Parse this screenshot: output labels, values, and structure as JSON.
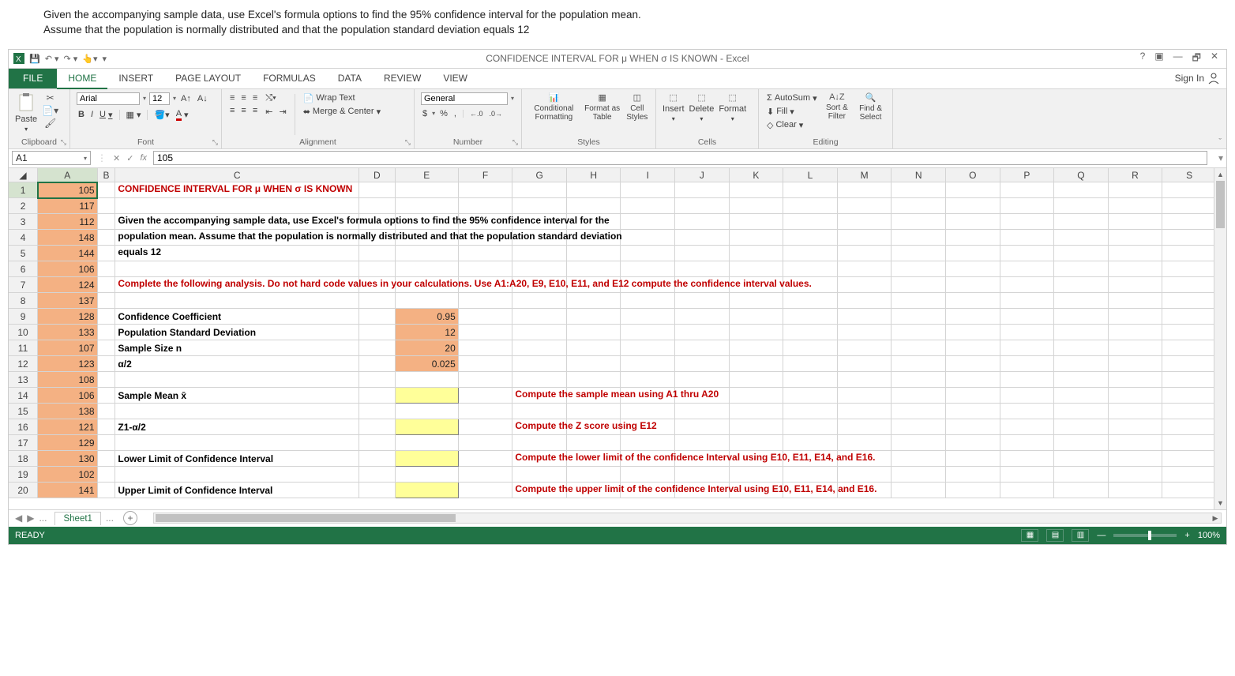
{
  "problem": {
    "line1": "Given the accompanying sample data, use Excel's formula options to find the 95% confidence interval for the population mean.",
    "line2": "Assume that the population is normally distributed and that the population standard deviation equals 12"
  },
  "titlebar": {
    "doc_title": "CONFIDENCE INTERVAL FOR μ WHEN σ IS KNOWN - Excel",
    "help": "?",
    "ribbon_opts": "▣",
    "minimize": "—",
    "restore": "🗗",
    "close": "✕"
  },
  "tabs": {
    "file": "FILE",
    "items": [
      "HOME",
      "INSERT",
      "PAGE LAYOUT",
      "FORMULAS",
      "DATA",
      "REVIEW",
      "VIEW"
    ],
    "sign_in": "Sign In"
  },
  "ribbon": {
    "clipboard": {
      "label": "Clipboard",
      "paste": "Paste"
    },
    "font": {
      "label": "Font",
      "name": "Arial",
      "size": "12",
      "bold": "B",
      "italic": "I",
      "underline": "U"
    },
    "alignment": {
      "label": "Alignment",
      "wrap": "Wrap Text",
      "merge": "Merge & Center"
    },
    "number": {
      "label": "Number",
      "format": "General",
      "currency": "$",
      "percent": "%",
      "comma": ",",
      "inc": "←.0 .00",
      "dec": ".00 →.0"
    },
    "styles": {
      "label": "Styles",
      "cond": "Conditional Formatting",
      "fat": "Format as Table",
      "cell": "Cell Styles"
    },
    "cells": {
      "label": "Cells",
      "insert": "Insert",
      "delete": "Delete",
      "format": "Format"
    },
    "editing": {
      "label": "Editing",
      "autosum": "AutoSum",
      "fill": "Fill",
      "clear": "Clear",
      "sort": "Sort & Filter",
      "find": "Find & Select"
    }
  },
  "namebox": {
    "ref": "A1",
    "fx": "fx",
    "formula": "105"
  },
  "columns": [
    "A",
    "B",
    "C",
    "D",
    "E",
    "F",
    "G",
    "H",
    "I",
    "J",
    "K",
    "L",
    "M",
    "N",
    "O",
    "P",
    "Q",
    "R",
    "S"
  ],
  "rows": [
    1,
    2,
    3,
    4,
    5,
    6,
    7,
    8,
    9,
    10,
    11,
    12,
    13,
    14,
    15,
    16,
    17,
    18,
    19,
    20
  ],
  "data_A": [
    "105",
    "117",
    "112",
    "148",
    "144",
    "106",
    "124",
    "137",
    "128",
    "133",
    "107",
    "123",
    "108",
    "106",
    "138",
    "121",
    "129",
    "130",
    "102",
    "141"
  ],
  "content": {
    "title": "CONFIDENCE INTERVAL FOR μ WHEN σ IS KNOWN",
    "desc1": "Given the accompanying sample data, use Excel's formula options to find the 95% confidence interval for the",
    "desc2": "population mean. Assume that the population is normally distributed and that the population standard deviation",
    "desc3": "equals 12",
    "instr": "Complete the following analysis. Do not hard code values in your calculations.  Use A1:A20, E9, E10, E11, and E12 compute the confidence interval values.",
    "r9c": "Confidence Coefficient",
    "r9e": "0.95",
    "r10c": "Population Standard Deviation",
    "r10e": "12",
    "r11c": "Sample Size n",
    "r11e": "20",
    "r12c": "α/2",
    "r12e": "0.025",
    "r14c": "Sample Mean x̄",
    "r14g": "Compute the sample mean using A1 thru A20",
    "r16c": "Z1-α/2",
    "r16g": "Compute the Z score  using E12",
    "r18c": "Lower Limit of Confidence Interval",
    "r18g": "Compute the lower limit of the confidence Interval using E10, E11, E14, and E16.",
    "r20c": "Upper Limit of Confidence Interval",
    "r20g": "Compute the upper limit of the confidence Interval using E10, E11, E14, and E16."
  },
  "sheettab": {
    "name": "Sheet1",
    "dots": "..."
  },
  "status": {
    "ready": "READY",
    "zoom": "100%"
  }
}
